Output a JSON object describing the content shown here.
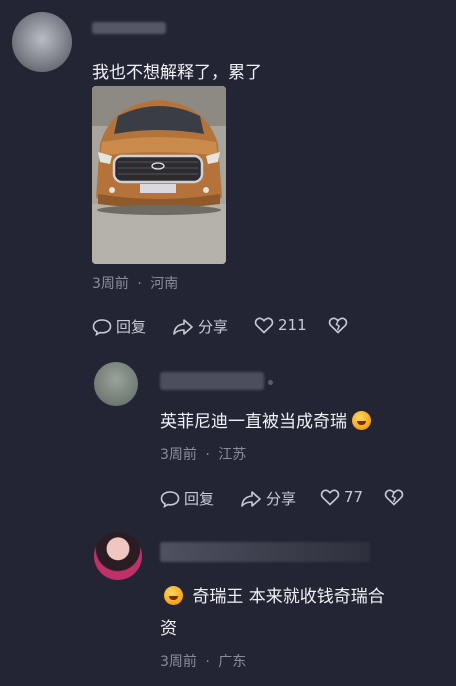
{
  "comments": [
    {
      "text": "我也不想解释了，累了",
      "time": "3周前",
      "location": "河南",
      "sep": "·",
      "actions": {
        "reply": "回复",
        "share": "分享",
        "likes": "211"
      }
    },
    {
      "text": "英菲尼迪一直被当成奇瑞",
      "emoji": "laughing-crying-emoji",
      "time": "3周前",
      "location": "江苏",
      "sep": "·",
      "actions": {
        "reply": "回复",
        "share": "分享",
        "likes": "77"
      }
    },
    {
      "text_line1": "奇瑞王 本来就收钱奇瑞合",
      "text_line2": "资",
      "emoji": "laughing-emoji",
      "time": "3周前",
      "location": "广东",
      "sep": "·"
    }
  ],
  "icons": [
    "reply-icon",
    "share-icon",
    "like-icon",
    "dislike-icon"
  ],
  "colors": {
    "background": "#232535",
    "text": "#f1f2f6",
    "meta": "#8a8c99"
  }
}
